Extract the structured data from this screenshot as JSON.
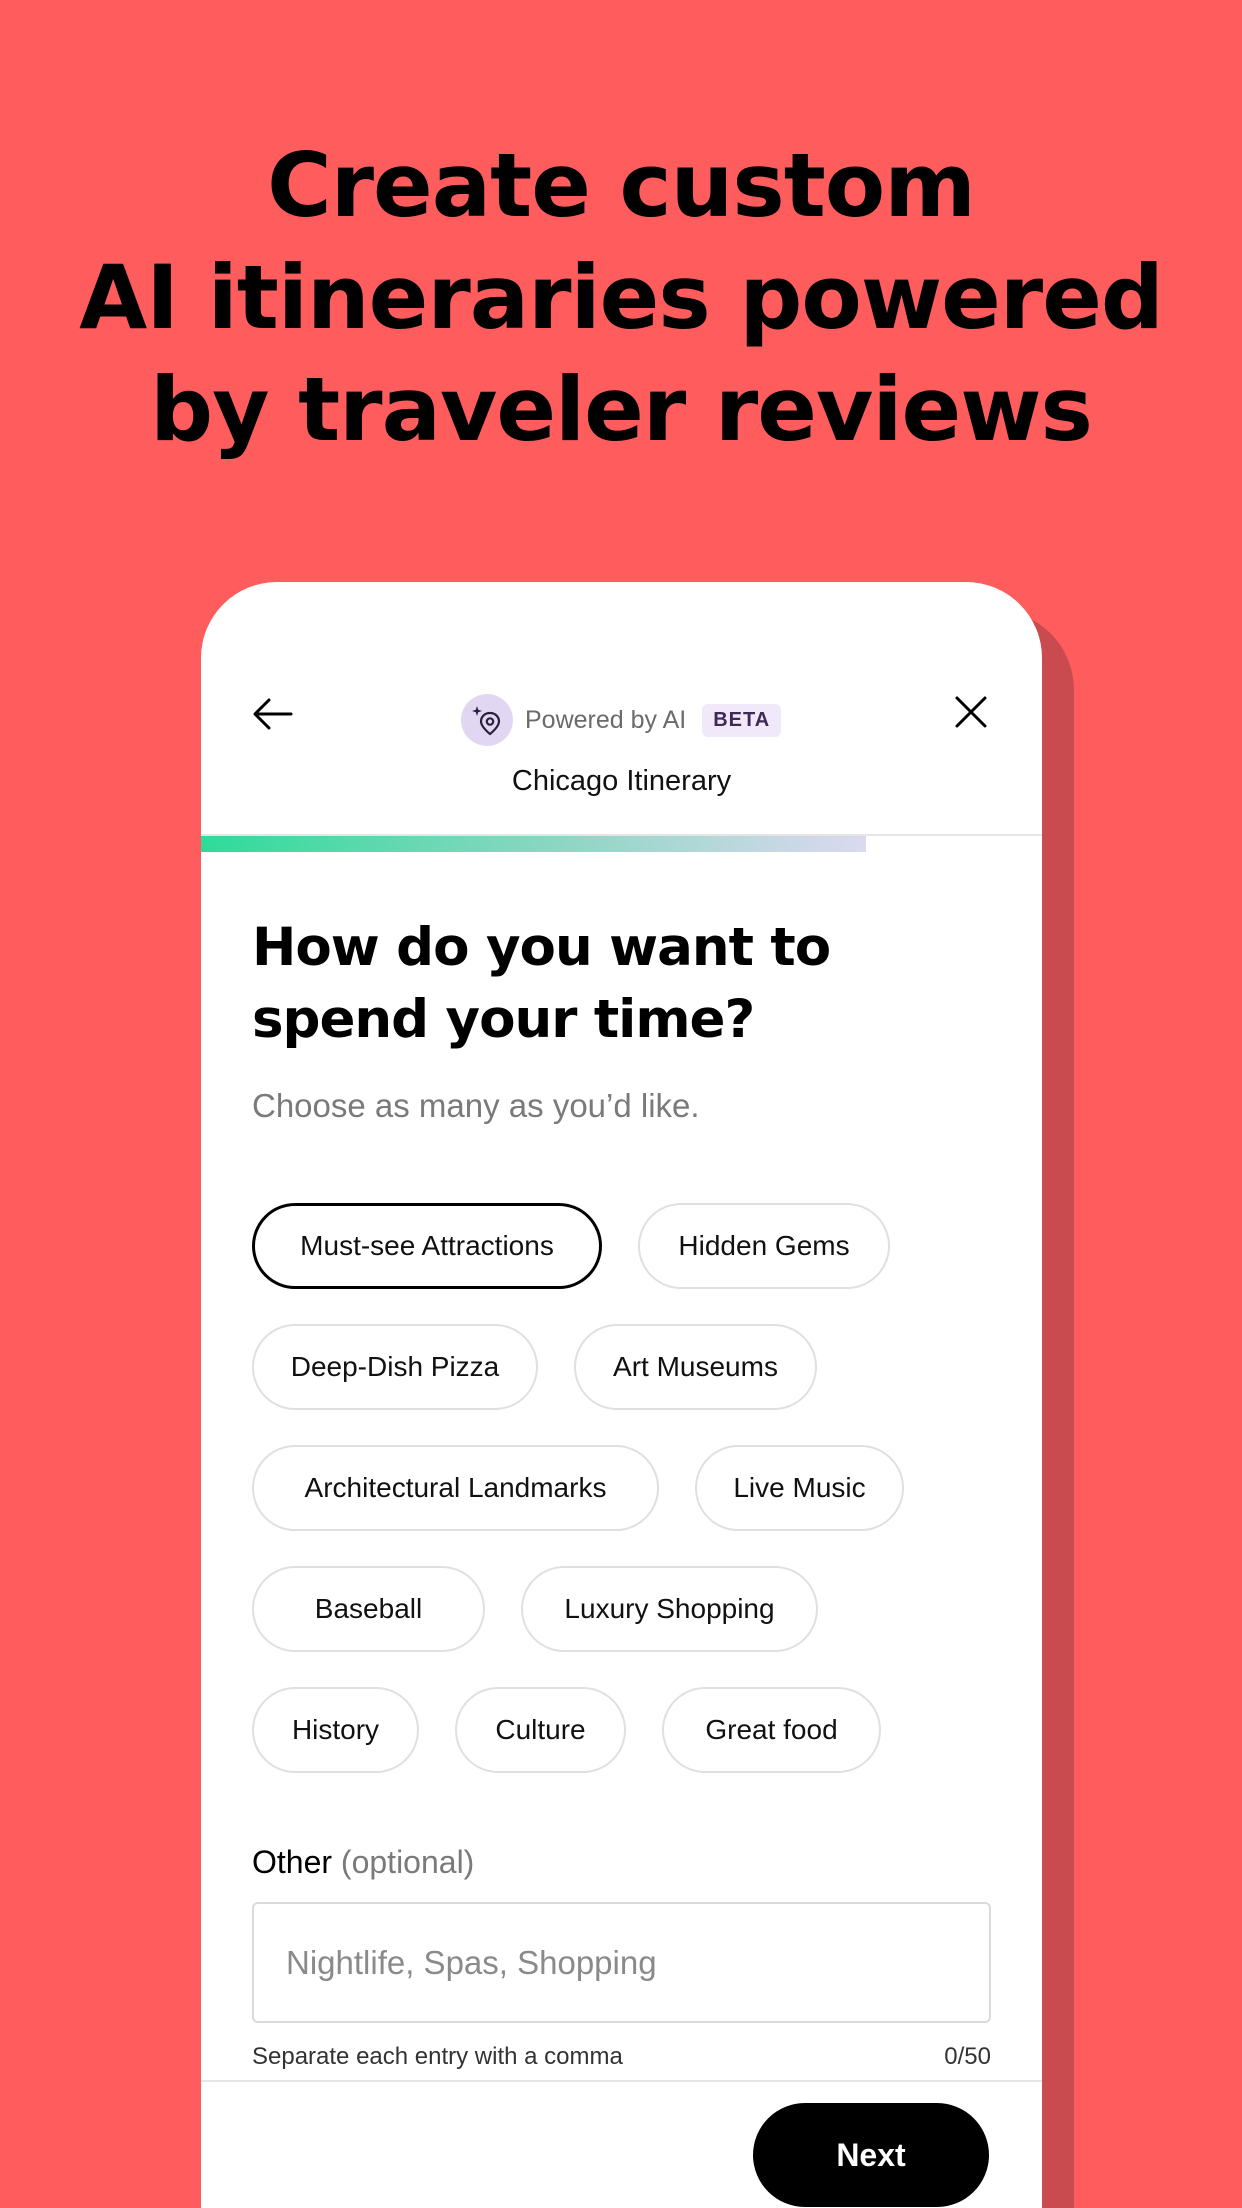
{
  "headline": {
    "line1": "Create custom",
    "line2": "AI itineraries powered",
    "line3": "by traveler reviews"
  },
  "header": {
    "powered_label": "Powered by AI",
    "beta_badge": "BETA",
    "trip_title": "Chicago Itinerary"
  },
  "progress": {
    "fraction": 0.79
  },
  "question": {
    "title": "How do you want to spend your time?",
    "subtitle": "Choose as many as you’d like."
  },
  "chips": [
    {
      "label": "Must-see Attractions",
      "selected": true
    },
    {
      "label": "Hidden Gems",
      "selected": false
    },
    {
      "label": "Deep-Dish Pizza",
      "selected": false
    },
    {
      "label": "Art Museums",
      "selected": false
    },
    {
      "label": "Architectural Landmarks",
      "selected": false
    },
    {
      "label": "Live Music",
      "selected": false
    },
    {
      "label": "Baseball",
      "selected": false
    },
    {
      "label": "Luxury Shopping",
      "selected": false
    },
    {
      "label": "History",
      "selected": false
    },
    {
      "label": "Culture",
      "selected": false
    },
    {
      "label": "Great food",
      "selected": false
    }
  ],
  "other": {
    "label": "Other",
    "optional": "(optional)",
    "value": "",
    "placeholder": "Nightlife, Spas, Shopping",
    "hint": "Separate each entry with a comma",
    "counter": "0/50"
  },
  "footer": {
    "next_label": "Next"
  },
  "colors": {
    "background": "#FF5D5D",
    "progress_start": "#2FDB9A",
    "ai_icon_bg": "#E2D7F3"
  }
}
